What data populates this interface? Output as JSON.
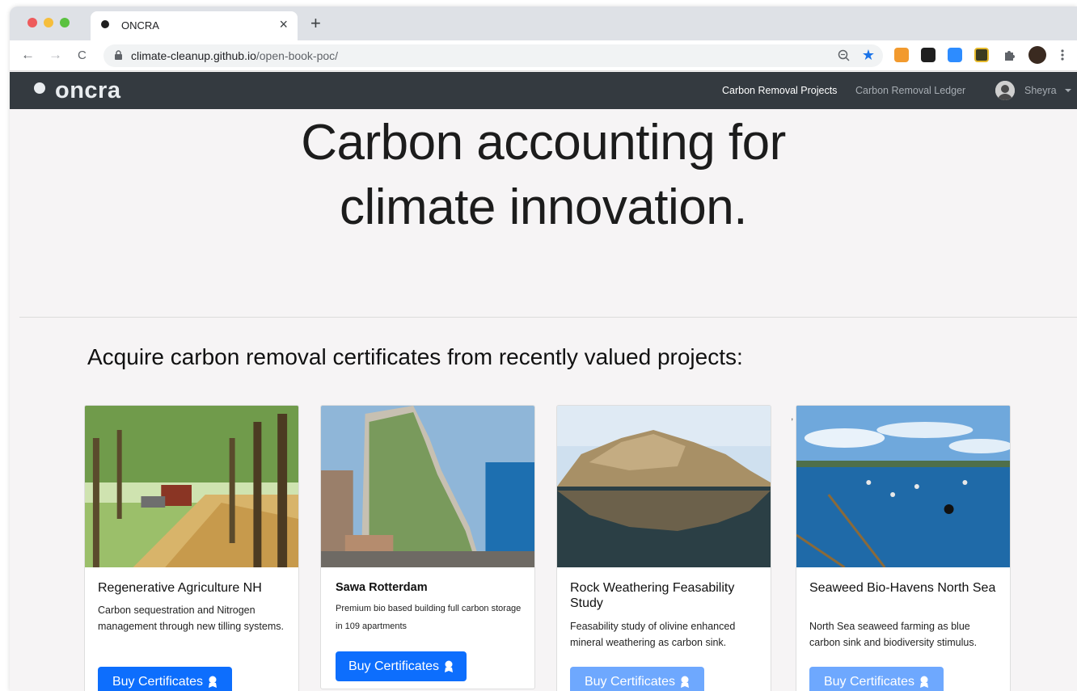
{
  "browser": {
    "tab_title": "ONCRA",
    "tab_close": "×",
    "new_tab": "+",
    "url_host": "climate-cleanup.github.io",
    "url_path": "/open-book-poc/",
    "star": "★",
    "back": "←",
    "forward": "→",
    "reload": "C"
  },
  "navbar": {
    "brand": "oncra",
    "links": [
      "Carbon Removal Projects",
      "Carbon Removal Ledger"
    ],
    "user": "Sheyra"
  },
  "hero": {
    "line1": "Carbon accounting for",
    "line2": "climate innovation."
  },
  "section": {
    "title": "Acquire carbon removal certificates from recently valued projects:"
  },
  "stray_mark": ",",
  "cards": [
    {
      "title": "Regenerative Agriculture NH",
      "description": "Carbon sequestration and Nitrogen management through new tilling systems.",
      "button": "Buy Certificates"
    },
    {
      "title": "Sawa Rotterdam",
      "description": "Premium bio based building full carbon storage in 109 apartments",
      "button": "Buy Certificates"
    },
    {
      "title": "Rock Weathering Feasability Study",
      "description": "Feasability study of olivine enhanced mineral weathering as carbon sink.",
      "button": "Buy Certificates"
    },
    {
      "title": "Seaweed Bio-Havens North Sea",
      "description": "North Sea seaweed farming as blue carbon sink and biodiversity stimulus.",
      "button": "Buy Certificates"
    }
  ],
  "colors": {
    "navbar": "#343a40",
    "primary_button": "#0d6efd",
    "disabled_button": "#6ea8fe"
  }
}
